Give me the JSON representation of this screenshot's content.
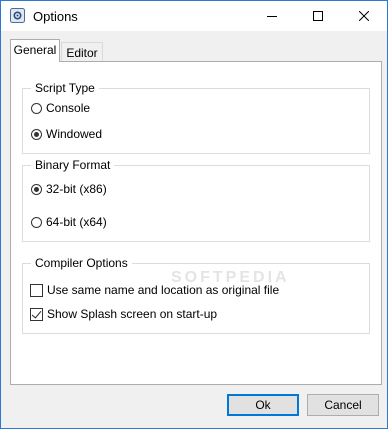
{
  "window": {
    "title": "Options",
    "app_icon": "gear-icon"
  },
  "tabs": [
    {
      "label": "General",
      "active": true
    },
    {
      "label": "Editor",
      "active": false
    }
  ],
  "script_type": {
    "legend": "Script Type",
    "options": [
      {
        "label": "Console",
        "selected": false
      },
      {
        "label": "Windowed",
        "selected": true
      }
    ]
  },
  "binary_format": {
    "legend": "Binary Format",
    "options": [
      {
        "label": "32-bit (x86)",
        "selected": true
      },
      {
        "label": "64-bit (x64)",
        "selected": false
      }
    ]
  },
  "compiler_options": {
    "legend": "Compiler Options",
    "items": [
      {
        "label": "Use same name and location as original file",
        "checked": false
      },
      {
        "label": "Show Splash screen on start-up",
        "checked": true
      }
    ]
  },
  "watermark": "SOFTPEDIA",
  "buttons": {
    "ok": "Ok",
    "cancel": "Cancel"
  },
  "colors": {
    "accent": "#0078d7",
    "window_border": "#2b79d0"
  }
}
